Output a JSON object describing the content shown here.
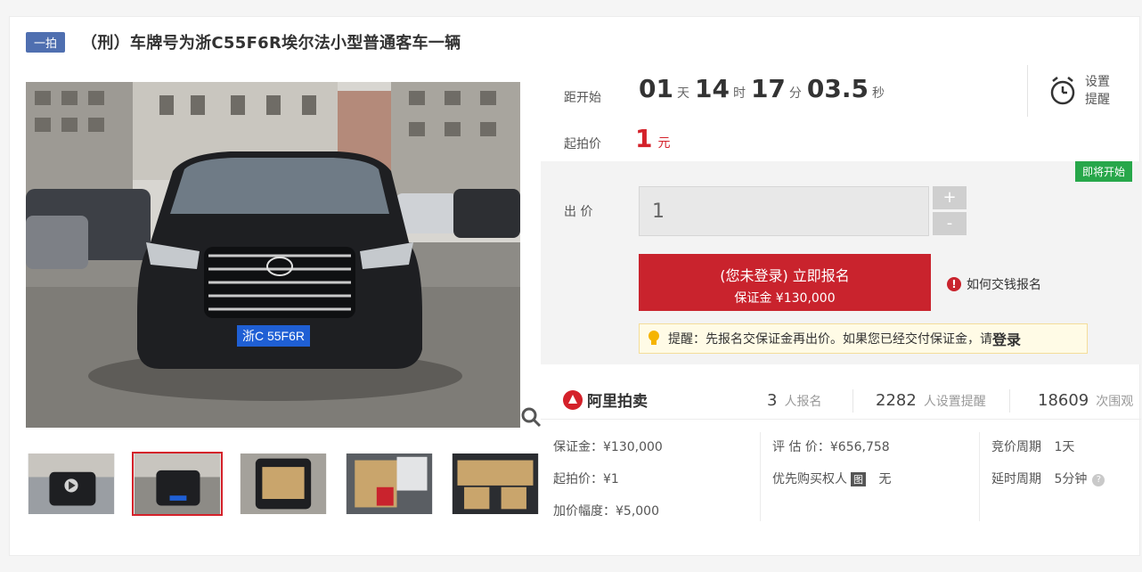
{
  "header": {
    "tag": "一拍",
    "title": "（刑）车牌号为浙C55F6R埃尔法小型普通客车一辆"
  },
  "gallery": {
    "plate_text": "浙C 55F6R",
    "thumb_count": 5,
    "active_thumb": 2
  },
  "countdown": {
    "label": "距开始",
    "days": "01",
    "days_unit": "天",
    "hours": "14",
    "hours_unit": "时",
    "minutes": "17",
    "minutes_unit": "分",
    "seconds": "03.5",
    "seconds_unit": "秒"
  },
  "start_price": {
    "label": "起拍价",
    "value": "1",
    "unit": "元"
  },
  "reminder": {
    "label": "设置提醒"
  },
  "bid": {
    "badge": "即将开始",
    "label": "出 价",
    "input_value": "1",
    "plus": "+",
    "minus": "-",
    "signup_main": "(您未登录) 立即报名",
    "signup_sub": "保证金 ¥130,000",
    "howto": "如何交钱报名",
    "tip_text": "提醒：先报名交保证金再出价。如果您已经交付保证金，请",
    "tip_link": "登录"
  },
  "stats": {
    "brand": "阿里拍卖",
    "signups_num": "3",
    "signups_label": "人报名",
    "reminders_num": "2282",
    "reminders_label": "人设置提醒",
    "views_num": "18609",
    "views_label": "次围观"
  },
  "details": {
    "deposit": "保证金：¥130,000",
    "start": "起拍价：¥1",
    "increment": "加价幅度：¥5,000",
    "appraisal": "评 估 价：¥656,758",
    "priority": "优先购买权人",
    "priority_badge": "图",
    "priority_value": "无",
    "cycle": "竞价周期",
    "cycle_value": "1天",
    "delay": "延时周期",
    "delay_value": "5分钟"
  },
  "colors": {
    "accent_red": "#c9232d",
    "tag_blue": "#4f6fb0",
    "badge_green": "#27a74a"
  }
}
